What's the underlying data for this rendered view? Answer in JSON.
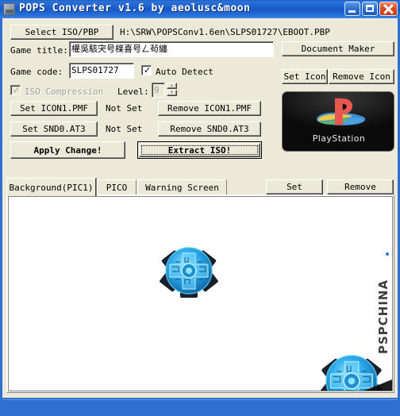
{
  "window": {
    "title": "POPS Converter v1.6 by aeolusc&moon",
    "icon": "app-icon",
    "controls": {
      "minimize": "minimize-icon",
      "maximize": "maximize-icon",
      "close": "close-icon"
    }
  },
  "toolbar": {
    "select_iso_button": "Select ISO/PBP",
    "path_value": "H:\\SRW\\POPSConv1.6en\\SLPS01727\\EBOOT.PBP",
    "document_maker_button": "Document Maker"
  },
  "form": {
    "game_title_label": "Game title:",
    "game_title_value": "權吳駭宊号檪喜号ㄥ茍纏",
    "game_code_label": "Game code:",
    "game_code_value": "SLPS01727",
    "auto_detect_label": "Auto Detect",
    "auto_detect_checked": true,
    "iso_compression_label": "ISO Compression",
    "iso_compression_checked": true,
    "iso_compression_enabled": false,
    "level_label": "Level:",
    "level_value": "9",
    "level_enabled": false
  },
  "icon_panel": {
    "set_icon_button": "Set Icon",
    "remove_icon_button": "Remove Icon",
    "preview_caption": "PlayStation",
    "preview_alt": "playstation-logo"
  },
  "media_rows": [
    {
      "set_button": "Set ICON1.PMF",
      "status": "Not Set",
      "remove_button": "Remove ICON1.PMF"
    },
    {
      "set_button": "Set SND0.AT3",
      "status": "Not Set",
      "remove_button": "Remove SND0.AT3"
    }
  ],
  "actions": {
    "apply_button": "Apply Change!",
    "extract_button": "Extract ISO!"
  },
  "tabs": {
    "items": [
      {
        "label": "Background(PIC1)",
        "active": true
      },
      {
        "label": "PICO",
        "active": false
      },
      {
        "label": "Warning Screen",
        "active": false
      }
    ],
    "set_button": "Set",
    "remove_button": "Remove"
  },
  "preview": {
    "watermark": "PSPCHINA",
    "emblems": [
      {
        "name": "tech-emblem-1"
      },
      {
        "name": "tech-emblem-2"
      }
    ]
  },
  "colors": {
    "titlebar_blue": "#1c5fcd",
    "face": "#ece9d8",
    "ps_red": "#e8564f",
    "ps_blue": "#3c8fd6",
    "ps_yellow": "#e9c84a",
    "ps_green": "#5eb36a",
    "emblem_cyan": "#29a9e6"
  }
}
